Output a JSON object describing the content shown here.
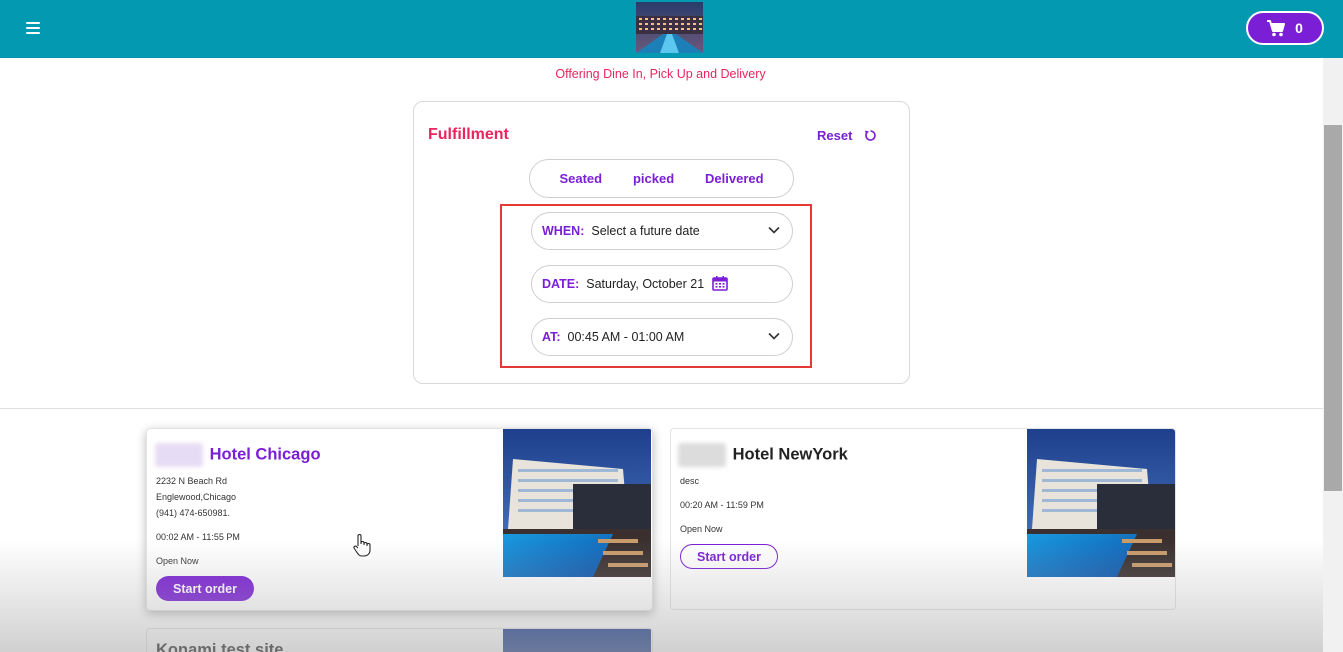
{
  "header": {
    "cart_count": "0",
    "tagline": "Offering Dine In, Pick Up and Delivery"
  },
  "fulfillment": {
    "title": "Fulfillment",
    "reset_label": "Reset",
    "tabs": [
      {
        "label": "Seated"
      },
      {
        "label": "picked"
      },
      {
        "label": "Delivered"
      }
    ],
    "when": {
      "label": "WHEN:",
      "value": "Select a future date"
    },
    "date": {
      "label": "DATE:",
      "value": "Saturday, October 21"
    },
    "at": {
      "label": "AT:",
      "value": "00:45 AM - 01:00 AM"
    }
  },
  "stores": [
    {
      "name": "Hotel Chicago",
      "address1": "2232 N Beach Rd",
      "address2": "Englewood,Chicago",
      "phone": "(941) 474-650981.",
      "hours": "00:02 AM - 11:55 PM",
      "status": "Open Now",
      "button": "Start order"
    },
    {
      "name": "Hotel NewYork",
      "desc": "desc",
      "hours": "00:20 AM - 11:59 PM",
      "status": "Open Now",
      "button": "Start order"
    },
    {
      "name": "Konami test site"
    }
  ],
  "colors": {
    "header": "#0399b1",
    "accent": "#7a1fd6",
    "title_pink": "#e8255f",
    "highlight": "#e53935"
  }
}
